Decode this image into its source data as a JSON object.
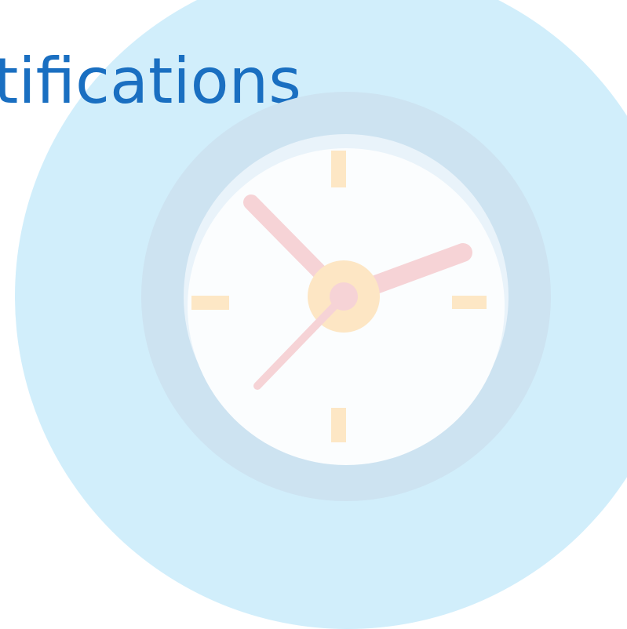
{
  "page": {
    "title": "tifications"
  },
  "palette": {
    "backdrop": "#d1eefb",
    "clock_ring": "#cde3f1",
    "clock_face": "#fbfdfe",
    "clock_face_shade": "#e9f3fa",
    "ticks": "#fde7c5",
    "hands": "#f6d3d6",
    "hub_outer": "#fde6c4",
    "hub_inner": "#f6d3d6",
    "title_text": "#1a6fc1"
  },
  "icons": [
    "clock-icon"
  ]
}
